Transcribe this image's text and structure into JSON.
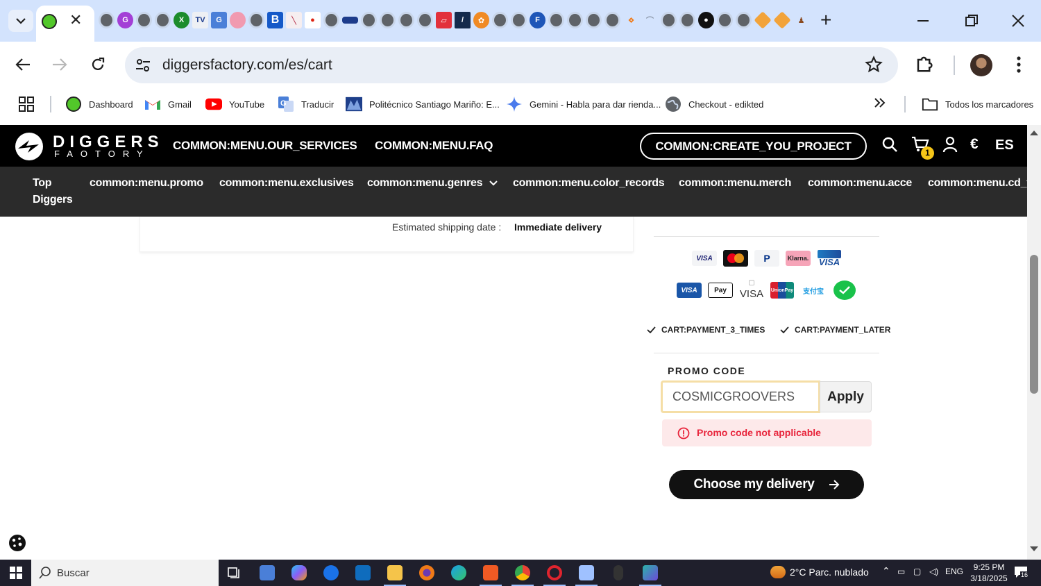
{
  "browser": {
    "url": "diggersfactory.com/es/cart",
    "bookmarks": [
      {
        "label": "Dashboard",
        "icon": "dashboard-icon"
      },
      {
        "label": "Gmail",
        "icon": "gmail-icon"
      },
      {
        "label": "YouTube",
        "icon": "youtube-icon"
      },
      {
        "label": "Traducir",
        "icon": "translate-icon"
      },
      {
        "label": "Politécnico Santiago Mariño: E...",
        "icon": "institution-icon"
      },
      {
        "label": "Gemini - Habla para dar rienda...",
        "icon": "gemini-icon"
      },
      {
        "label": "Checkout - edikted",
        "icon": "globe-icon"
      }
    ],
    "all_bookmarks": "Todos los marcadores"
  },
  "site": {
    "logo_main": "DIGGERS",
    "logo_sub": "FAOTORY",
    "nav": {
      "services": "COMMON:MENU.OUR_SERVICES",
      "faq": "COMMON:MENU.FAQ",
      "create_project": "COMMON:CREATE_YOU_PROJECT"
    },
    "cart_count": "1",
    "currency": "€",
    "language": "ES",
    "categories": [
      "Top Diggers",
      "common:menu.promo",
      "common:menu.exclusives",
      "common:menu.genres",
      "common:menu.color_records",
      "common:menu.merch",
      "common:menu.acce",
      "common:menu.cd_t"
    ]
  },
  "cart": {
    "shipping_label": "Estimated shipping date :",
    "shipping_value": "Immediate delivery",
    "payment_methods": [
      "VISA",
      "mastercard",
      "PayPal",
      "Klarna.",
      "CB VISA",
      "VISA Electron",
      "Apple Pay",
      "VISA",
      "UnionPay",
      "Alipay",
      "WeChat"
    ],
    "features": [
      "CART:PAYMENT_3_TIMES",
      "CART:PAYMENT_LATER"
    ],
    "promo_label": "PROMO CODE",
    "promo_value": "COSMICGROOVERS",
    "apply_label": "Apply",
    "promo_error": "Promo code not applicable",
    "delivery_button": "Choose my delivery",
    "colors": {
      "error": "#e8243b",
      "error_bg": "#fde9ea",
      "badge": "#f5c518",
      "header": "#000000",
      "nav": "#2b2b2b"
    }
  },
  "taskbar": {
    "search_placeholder": "Buscar",
    "weather": "2°C  Parc. nublado",
    "language": "ENG",
    "time": "9:25 PM",
    "date": "3/18/2025",
    "notifications": "16"
  }
}
